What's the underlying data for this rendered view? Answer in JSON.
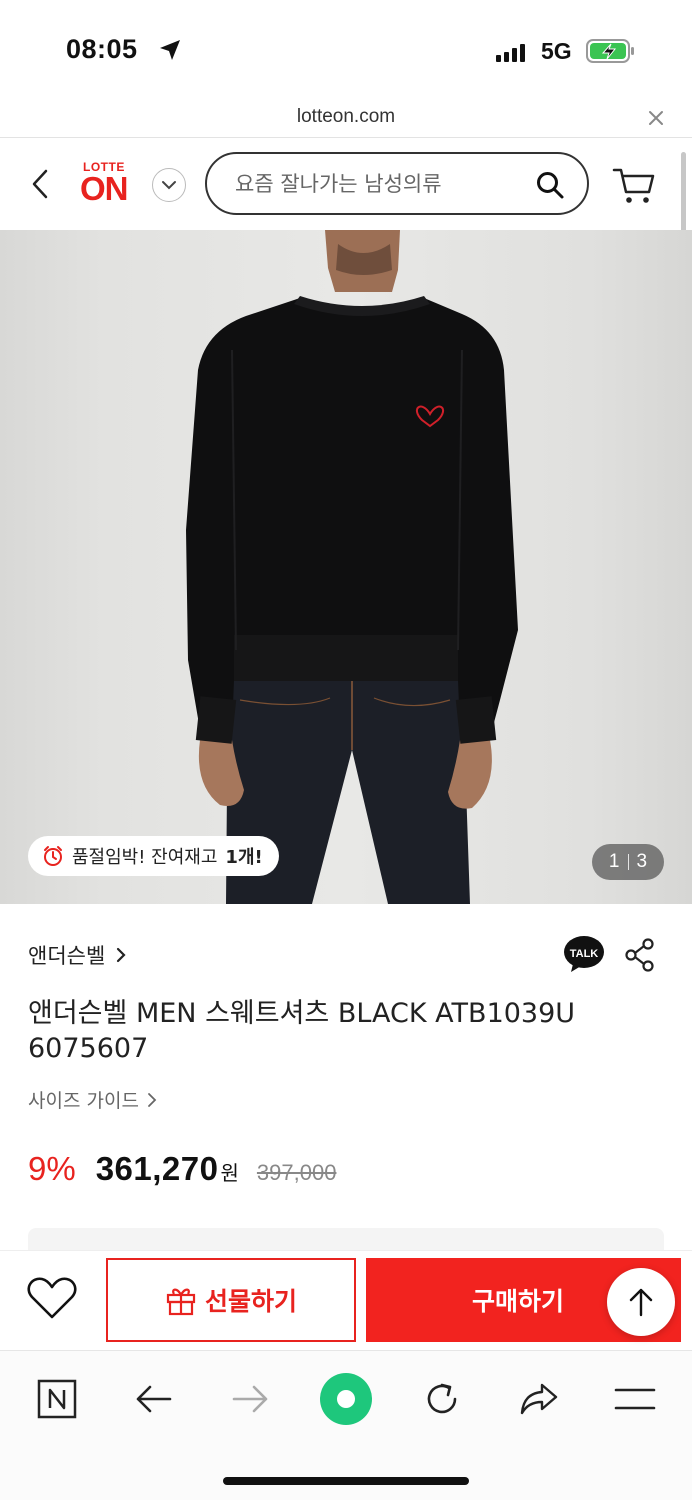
{
  "status_bar": {
    "time": "08:05",
    "network": "5G"
  },
  "browser": {
    "url": "lotteon.com"
  },
  "header": {
    "logo_top": "LOTTE",
    "logo_main": "ON",
    "search_placeholder": "요즘 잘나가는 남성의류"
  },
  "gallery": {
    "stock_text": "품절임박! 잔여재고",
    "stock_count": "1개!",
    "current_page": "1",
    "total_pages": "3"
  },
  "product": {
    "brand": "앤더슨벨",
    "talk_label": "TALK",
    "title": "앤더슨벨 MEN 스웨트셔츠 BLACK ATB1039U 6075607",
    "size_guide": "사이즈 가이드",
    "discount": "9%",
    "price": "361,270",
    "currency": "원",
    "original_price": "397,000"
  },
  "actions": {
    "gift_label": "선물하기",
    "buy_label": "구매하기"
  },
  "colors": {
    "brand_red": "#e8231f",
    "buy_red": "#f2231f"
  },
  "icons": [
    "location-arrow-icon",
    "signal-icon",
    "battery-charging-icon",
    "close-icon",
    "back-chevron-icon",
    "chevron-down-icon",
    "search-icon",
    "cart-icon",
    "alarm-clock-icon",
    "chevron-right-icon",
    "talk-icon",
    "share-icon",
    "heart-icon",
    "gift-icon",
    "arrow-up-icon",
    "naver-n-icon",
    "arrow-left-icon",
    "arrow-right-icon",
    "green-dot-icon",
    "refresh-icon",
    "share-arrow-icon",
    "menu-icon"
  ]
}
